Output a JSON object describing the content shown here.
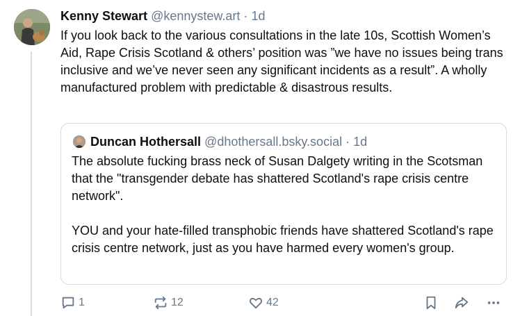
{
  "post": {
    "author": "Kenny Stewart",
    "handle": "@kennystew.art",
    "separator": "·",
    "time": "1d",
    "text": "If you look back to the various consultations in the late 10s, Scottish Women’s Aid, Rape Crisis Scotland & others’ position was ”we have no issues being trans inclusive and we’ve never seen any significant incidents as a result”. A wholly manufactured problem with predictable & disastrous results."
  },
  "quote": {
    "author": "Duncan Hothersall",
    "handle": "@dhothersall.bsky.social",
    "separator": "·",
    "time": "1d",
    "text": "The absolute fucking brass neck of Susan Dalgety writing in the Scotsman that the \"transgender debate has shattered Scotland's rape crisis centre network\".\n\nYOU and your hate-filled transphobic friends have shattered Scotland's rape crisis centre network, just as you have harmed every women's group."
  },
  "actions": {
    "reply_count": "1",
    "repost_count": "12",
    "like_count": "42"
  },
  "icons": [
    "reply-icon",
    "repost-icon",
    "like-icon",
    "bookmark-icon",
    "share-icon",
    "more-icon"
  ],
  "colors": {
    "muted": "#66788a",
    "border": "#d4dbe2",
    "text": "#0b0f14"
  }
}
